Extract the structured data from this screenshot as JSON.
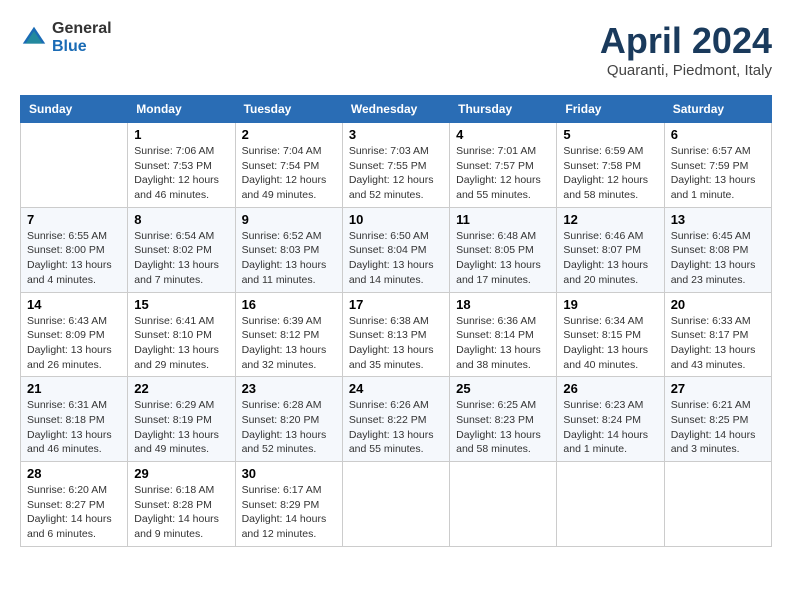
{
  "header": {
    "logo_general": "General",
    "logo_blue": "Blue",
    "title": "April 2024",
    "subtitle": "Quaranti, Piedmont, Italy"
  },
  "columns": [
    "Sunday",
    "Monday",
    "Tuesday",
    "Wednesday",
    "Thursday",
    "Friday",
    "Saturday"
  ],
  "weeks": [
    [
      {
        "day": "",
        "info": ""
      },
      {
        "day": "1",
        "info": "Sunrise: 7:06 AM\nSunset: 7:53 PM\nDaylight: 12 hours\nand 46 minutes."
      },
      {
        "day": "2",
        "info": "Sunrise: 7:04 AM\nSunset: 7:54 PM\nDaylight: 12 hours\nand 49 minutes."
      },
      {
        "day": "3",
        "info": "Sunrise: 7:03 AM\nSunset: 7:55 PM\nDaylight: 12 hours\nand 52 minutes."
      },
      {
        "day": "4",
        "info": "Sunrise: 7:01 AM\nSunset: 7:57 PM\nDaylight: 12 hours\nand 55 minutes."
      },
      {
        "day": "5",
        "info": "Sunrise: 6:59 AM\nSunset: 7:58 PM\nDaylight: 12 hours\nand 58 minutes."
      },
      {
        "day": "6",
        "info": "Sunrise: 6:57 AM\nSunset: 7:59 PM\nDaylight: 13 hours\nand 1 minute."
      }
    ],
    [
      {
        "day": "7",
        "info": "Sunrise: 6:55 AM\nSunset: 8:00 PM\nDaylight: 13 hours\nand 4 minutes."
      },
      {
        "day": "8",
        "info": "Sunrise: 6:54 AM\nSunset: 8:02 PM\nDaylight: 13 hours\nand 7 minutes."
      },
      {
        "day": "9",
        "info": "Sunrise: 6:52 AM\nSunset: 8:03 PM\nDaylight: 13 hours\nand 11 minutes."
      },
      {
        "day": "10",
        "info": "Sunrise: 6:50 AM\nSunset: 8:04 PM\nDaylight: 13 hours\nand 14 minutes."
      },
      {
        "day": "11",
        "info": "Sunrise: 6:48 AM\nSunset: 8:05 PM\nDaylight: 13 hours\nand 17 minutes."
      },
      {
        "day": "12",
        "info": "Sunrise: 6:46 AM\nSunset: 8:07 PM\nDaylight: 13 hours\nand 20 minutes."
      },
      {
        "day": "13",
        "info": "Sunrise: 6:45 AM\nSunset: 8:08 PM\nDaylight: 13 hours\nand 23 minutes."
      }
    ],
    [
      {
        "day": "14",
        "info": "Sunrise: 6:43 AM\nSunset: 8:09 PM\nDaylight: 13 hours\nand 26 minutes."
      },
      {
        "day": "15",
        "info": "Sunrise: 6:41 AM\nSunset: 8:10 PM\nDaylight: 13 hours\nand 29 minutes."
      },
      {
        "day": "16",
        "info": "Sunrise: 6:39 AM\nSunset: 8:12 PM\nDaylight: 13 hours\nand 32 minutes."
      },
      {
        "day": "17",
        "info": "Sunrise: 6:38 AM\nSunset: 8:13 PM\nDaylight: 13 hours\nand 35 minutes."
      },
      {
        "day": "18",
        "info": "Sunrise: 6:36 AM\nSunset: 8:14 PM\nDaylight: 13 hours\nand 38 minutes."
      },
      {
        "day": "19",
        "info": "Sunrise: 6:34 AM\nSunset: 8:15 PM\nDaylight: 13 hours\nand 40 minutes."
      },
      {
        "day": "20",
        "info": "Sunrise: 6:33 AM\nSunset: 8:17 PM\nDaylight: 13 hours\nand 43 minutes."
      }
    ],
    [
      {
        "day": "21",
        "info": "Sunrise: 6:31 AM\nSunset: 8:18 PM\nDaylight: 13 hours\nand 46 minutes."
      },
      {
        "day": "22",
        "info": "Sunrise: 6:29 AM\nSunset: 8:19 PM\nDaylight: 13 hours\nand 49 minutes."
      },
      {
        "day": "23",
        "info": "Sunrise: 6:28 AM\nSunset: 8:20 PM\nDaylight: 13 hours\nand 52 minutes."
      },
      {
        "day": "24",
        "info": "Sunrise: 6:26 AM\nSunset: 8:22 PM\nDaylight: 13 hours\nand 55 minutes."
      },
      {
        "day": "25",
        "info": "Sunrise: 6:25 AM\nSunset: 8:23 PM\nDaylight: 13 hours\nand 58 minutes."
      },
      {
        "day": "26",
        "info": "Sunrise: 6:23 AM\nSunset: 8:24 PM\nDaylight: 14 hours\nand 1 minute."
      },
      {
        "day": "27",
        "info": "Sunrise: 6:21 AM\nSunset: 8:25 PM\nDaylight: 14 hours\nand 3 minutes."
      }
    ],
    [
      {
        "day": "28",
        "info": "Sunrise: 6:20 AM\nSunset: 8:27 PM\nDaylight: 14 hours\nand 6 minutes."
      },
      {
        "day": "29",
        "info": "Sunrise: 6:18 AM\nSunset: 8:28 PM\nDaylight: 14 hours\nand 9 minutes."
      },
      {
        "day": "30",
        "info": "Sunrise: 6:17 AM\nSunset: 8:29 PM\nDaylight: 14 hours\nand 12 minutes."
      },
      {
        "day": "",
        "info": ""
      },
      {
        "day": "",
        "info": ""
      },
      {
        "day": "",
        "info": ""
      },
      {
        "day": "",
        "info": ""
      }
    ]
  ]
}
